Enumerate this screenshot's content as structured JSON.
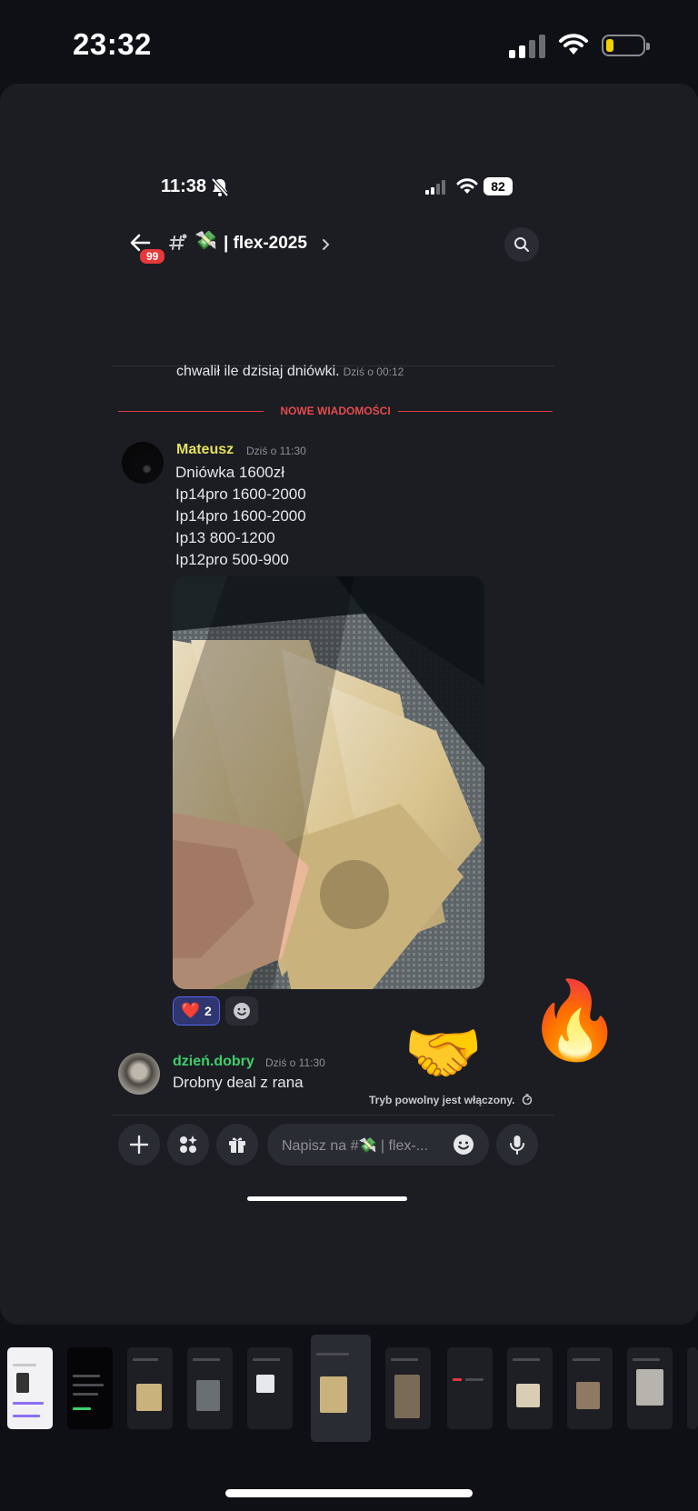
{
  "outer_status": {
    "time": "23:32"
  },
  "inner_status": {
    "time": "11:38",
    "battery": "82"
  },
  "channel": {
    "prefix_emoji": "💸",
    "name": "| flex-2025",
    "unread_badge": "99"
  },
  "previous_message": {
    "text": "chwalił ile dzisiaj dniówki.",
    "timestamp": "Dziś o 00:12"
  },
  "new_messages_label": "NOWE WIADOMOŚCI",
  "messages": [
    {
      "author": "Mateusz",
      "author_color": "#e3e05a",
      "timestamp": "Dziś o 11:30",
      "lines": [
        "Dniówka 1600zł",
        "Ip14pro 1600-2000",
        "Ip14pro 1600-2000",
        "Ip13 800-1200",
        "Ip12pro 500-900"
      ],
      "reaction": {
        "emoji": "❤️",
        "count": "2"
      }
    },
    {
      "author": "dzień.dobry",
      "author_color": "#3ecf6b",
      "timestamp": "Dziś o 11:30",
      "text": "Drobny deal z rana"
    }
  ],
  "overlay_emojis": [
    "🤝",
    "🔥"
  ],
  "slowmode": {
    "text": "Tryb powolny jest włączony."
  },
  "composer": {
    "placeholder": "Napisz na #💸 | flex-..."
  },
  "accent": "#5865f2",
  "icons": [
    "back-arrow-icon",
    "hash-icon",
    "chevron-right-icon",
    "search-icon",
    "plus-icon",
    "apps-icon",
    "gift-icon",
    "emoji-icon",
    "microphone-icon",
    "bell-off-icon",
    "timer-icon"
  ]
}
